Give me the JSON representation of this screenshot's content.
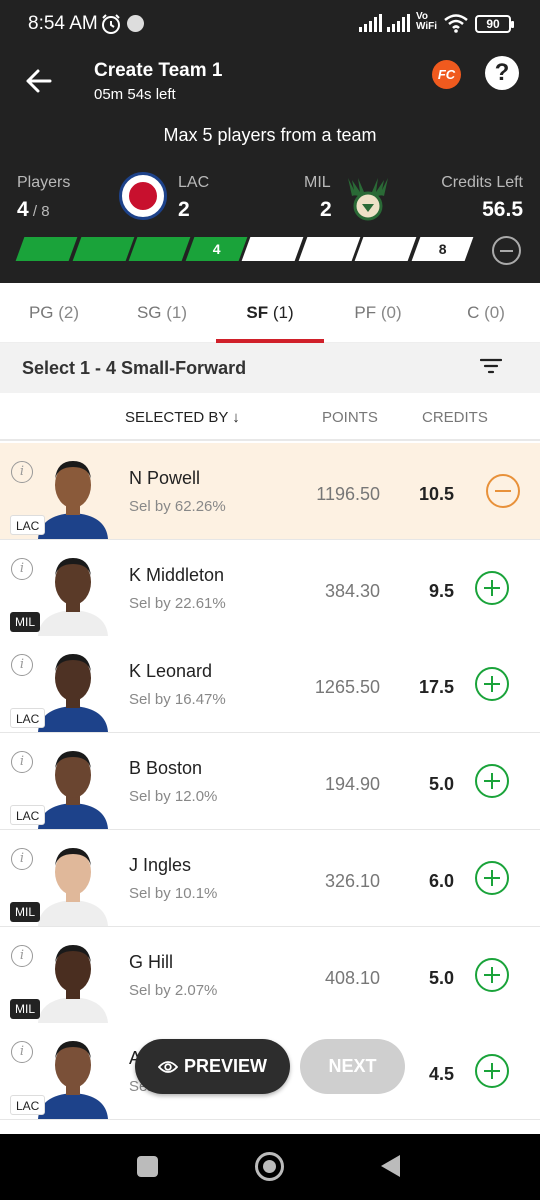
{
  "status": {
    "time": "8:54 AM",
    "vowifi_top": "Vo",
    "vowifi_bottom": "WiFi",
    "battery": "90"
  },
  "header": {
    "title": "Create Team 1",
    "time_left": "05m 54s left",
    "fc_label": "FC",
    "help_label": "?",
    "max_info": "Max 5 players from a team"
  },
  "summary": {
    "players_label": "Players",
    "players_selected": "4",
    "players_total": " / 8",
    "team1_abbr": "LAC",
    "team1_count": "2",
    "team2_abbr": "MIL",
    "team2_count": "2",
    "credits_label": "Credits Left",
    "credits_value": "56.5"
  },
  "progress": {
    "filled_segments": 4,
    "total_segments": 8,
    "filled_label": "4",
    "total_label": "8",
    "filled_color": "#1aa33a"
  },
  "tabs": [
    {
      "name": "PG",
      "count": "(2)",
      "active": false
    },
    {
      "name": "SG",
      "count": "(1)",
      "active": false
    },
    {
      "name": "SF",
      "count": "(1)",
      "active": true
    },
    {
      "name": "PF",
      "count": "(0)",
      "active": false
    },
    {
      "name": "C",
      "count": "(0)",
      "active": false
    }
  ],
  "select_text": "Select 1 - 4 Small-Forward",
  "columns": {
    "selected_by": "SELECTED BY ↓",
    "points": "POINTS",
    "credits": "CREDITS"
  },
  "players": [
    {
      "name": "N Powell",
      "sel": "Sel by 62.26%",
      "points": "1196.50",
      "credits": "10.5",
      "team": "LAC",
      "selected": true,
      "jersey": "#1d428a",
      "skin": "#8a5a3a"
    },
    {
      "name": "K Middleton",
      "sel": "Sel by 22.61%",
      "points": "384.30",
      "credits": "9.5",
      "team": "MIL",
      "selected": false,
      "jersey": "#eee",
      "skin": "#5a3a28"
    },
    {
      "name": "K Leonard",
      "sel": "Sel by 16.47%",
      "points": "1265.50",
      "credits": "17.5",
      "team": "LAC",
      "selected": false,
      "jersey": "#1d428a",
      "skin": "#4e3224"
    },
    {
      "name": "B Boston",
      "sel": "Sel by 12.0%",
      "points": "194.90",
      "credits": "5.0",
      "team": "LAC",
      "selected": false,
      "jersey": "#1d428a",
      "skin": "#6a4530"
    },
    {
      "name": "J Ingles",
      "sel": "Sel by 10.1%",
      "points": "326.10",
      "credits": "6.0",
      "team": "MIL",
      "selected": false,
      "jersey": "#eee",
      "skin": "#e0b89a"
    },
    {
      "name": "G Hill",
      "sel": "Sel by 2.07%",
      "points": "408.10",
      "credits": "5.0",
      "team": "MIL",
      "selected": false,
      "jersey": "#eee",
      "skin": "#4a2e20"
    },
    {
      "name": "A",
      "sel": "Sel",
      "points": "",
      "credits": "4.5",
      "team": "LAC",
      "selected": false,
      "jersey": "#1d428a",
      "skin": "#7a5038"
    }
  ],
  "buttons": {
    "preview": "PREVIEW",
    "next": "NEXT"
  }
}
